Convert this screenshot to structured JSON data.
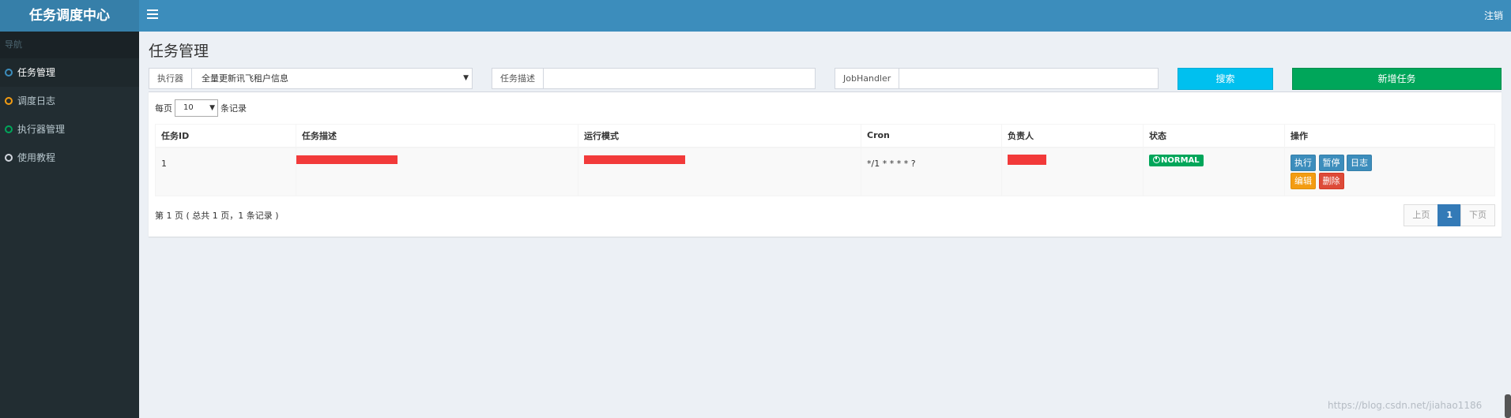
{
  "header": {
    "brand": "任务调度中心",
    "logout": "注销"
  },
  "sidebar": {
    "header": "导航",
    "items": [
      {
        "label": "任务管理",
        "color": "#3c8dbc"
      },
      {
        "label": "调度日志",
        "color": "#f39c12"
      },
      {
        "label": "执行器管理",
        "color": "#00a65a"
      },
      {
        "label": "使用教程",
        "color": "#d2d6de"
      }
    ]
  },
  "main": {
    "title": "任务管理",
    "filters": {
      "executor_label": "执行器",
      "executor_value": "全量更新讯飞租户信息",
      "desc_label": "任务描述",
      "desc_value": "",
      "handler_label": "JobHandler",
      "handler_value": ""
    },
    "search_button": "搜索",
    "add_button": "新增任务",
    "page_size": {
      "prefix": "每页",
      "value": "10",
      "suffix": "条记录"
    },
    "table": {
      "columns": [
        "任务ID",
        "任务描述",
        "运行模式",
        "Cron",
        "负责人",
        "状态",
        "操作"
      ],
      "rows": [
        {
          "id": "1",
          "cron": "*/1 * * * * ?",
          "status": "NORMAL"
        }
      ]
    },
    "actions": {
      "run": "执行",
      "pause": "暂停",
      "log": "日志",
      "edit": "编辑",
      "delete": "删除"
    },
    "page_info": "第 1 页 ( 总共 1 页，1 条记录 )",
    "pagination": {
      "prev": "上页",
      "current": "1",
      "next": "下页"
    }
  },
  "watermark": "https://blog.csdn.net/jiahao1186"
}
